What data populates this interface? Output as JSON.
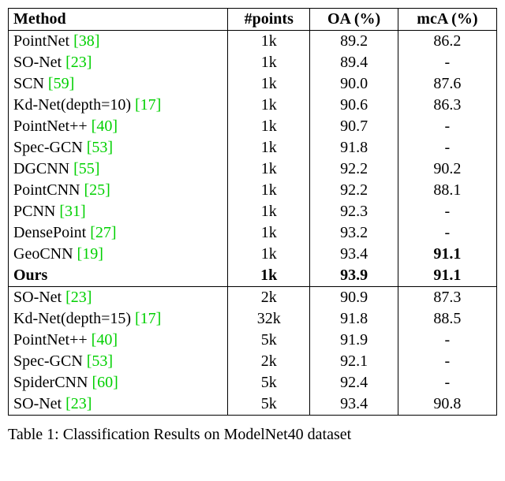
{
  "headers": {
    "method": "Method",
    "points": "#points",
    "oa": "OA (%)",
    "mca": "mcA (%)"
  },
  "section1": [
    {
      "name": "PointNet ",
      "cite": "[38]",
      "points": "1k",
      "oa": "89.2",
      "mca": "86.2",
      "bold": false
    },
    {
      "name": "SO-Net ",
      "cite": "[23]",
      "points": "1k",
      "oa": "89.4",
      "mca": "-",
      "bold": false
    },
    {
      "name": "SCN ",
      "cite": "[59]",
      "points": "1k",
      "oa": "90.0",
      "mca": "87.6",
      "bold": false
    },
    {
      "name": "Kd-Net(depth=10) ",
      "cite": "[17]",
      "points": "1k",
      "oa": "90.6",
      "mca": "86.3",
      "bold": false
    },
    {
      "name": "PointNet++ ",
      "cite": "[40]",
      "points": "1k",
      "oa": "90.7",
      "mca": "-",
      "bold": false
    },
    {
      "name": "Spec-GCN ",
      "cite": "[53]",
      "points": "1k",
      "oa": "91.8",
      "mca": "-",
      "bold": false
    },
    {
      "name": "DGCNN ",
      "cite": "[55]",
      "points": "1k",
      "oa": "92.2",
      "mca": "90.2",
      "bold": false
    },
    {
      "name": "PointCNN ",
      "cite": "[25]",
      "points": "1k",
      "oa": "92.2",
      "mca": "88.1",
      "bold": false
    },
    {
      "name": "PCNN ",
      "cite": "[31]",
      "points": "1k",
      "oa": "92.3",
      "mca": "-",
      "bold": false
    },
    {
      "name": "DensePoint ",
      "cite": "[27]",
      "points": "1k",
      "oa": "93.2",
      "mca": "-",
      "bold": false
    },
    {
      "name": "GeoCNN  ",
      "cite": "[19]",
      "points": "1k",
      "oa": "93.4",
      "mca": "91.1",
      "bold": false,
      "mca_bold": true
    },
    {
      "name": "Ours",
      "cite": "",
      "points": "1k",
      "oa": "93.9",
      "mca": "91.1",
      "bold": true
    }
  ],
  "section2": [
    {
      "name": "SO-Net ",
      "cite": "[23]",
      "points": "2k",
      "oa": "90.9",
      "mca": "87.3",
      "bold": false
    },
    {
      "name": "Kd-Net(depth=15) ",
      "cite": "[17]",
      "points": "32k",
      "oa": "91.8",
      "mca": "88.5",
      "bold": false
    },
    {
      "name": "PointNet++ ",
      "cite": "[40]",
      "points": "5k",
      "oa": "91.9",
      "mca": "-",
      "bold": false
    },
    {
      "name": "Spec-GCN ",
      "cite": "[53]",
      "points": "2k",
      "oa": "92.1",
      "mca": "-",
      "bold": false
    },
    {
      "name": "SpiderCNN ",
      "cite": "[60]",
      "points": "5k",
      "oa": "92.4",
      "mca": "-",
      "bold": false
    },
    {
      "name": "SO-Net ",
      "cite": "[23]",
      "points": "5k",
      "oa": "93.4",
      "mca": "90.8",
      "bold": false
    }
  ],
  "caption": "Table 1:  Classification Results on ModelNet40 dataset"
}
